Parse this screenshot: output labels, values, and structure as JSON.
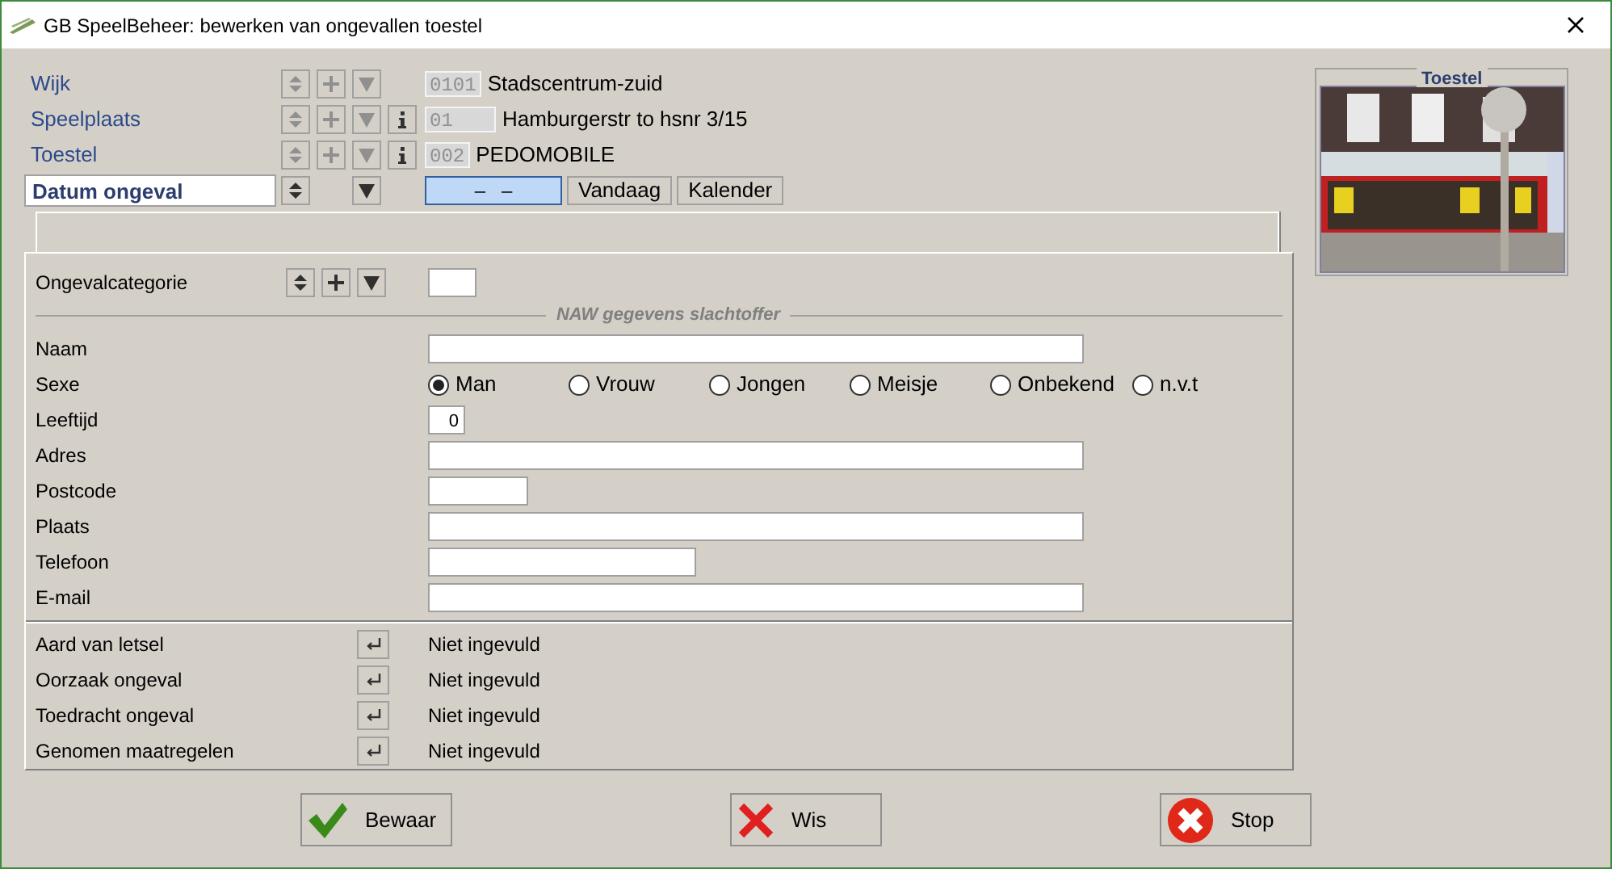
{
  "window": {
    "title": "GB SpeelBeheer: bewerken van ongevallen toestel"
  },
  "rows": [
    {
      "kind": "lookup",
      "label": "Wijk",
      "code": "0101",
      "name": "Stadscentrum-zuid",
      "info": false,
      "selected": false
    },
    {
      "kind": "lookup",
      "label": "Speelplaats",
      "code": "01",
      "name": "Hamburgerstr to hsnr 3/15",
      "info": true,
      "selected": false
    },
    {
      "kind": "lookup",
      "label": "Toestel",
      "code": "002",
      "name": "PEDOMOBILE",
      "info": true,
      "selected": false
    },
    {
      "kind": "date",
      "label": "Datum ongeval",
      "value": "–   –",
      "buttons": [
        "Vandaag",
        "Kalender"
      ],
      "selected": true
    }
  ],
  "category": {
    "label": "Ongevalcategorie"
  },
  "section": {
    "title": "NAW gegevens slachtoffer"
  },
  "fields": [
    {
      "kind": "long",
      "label": "Naam"
    },
    {
      "kind": "radio",
      "label": "Sexe",
      "options": [
        {
          "label": "Man",
          "selected": true
        },
        {
          "label": "Vrouw",
          "selected": false
        },
        {
          "label": "Jongen",
          "selected": false
        },
        {
          "label": "Meisje",
          "selected": false
        },
        {
          "label": "Onbekend",
          "selected": false
        },
        {
          "label": "n.v.t",
          "selected": false
        }
      ]
    },
    {
      "kind": "number",
      "label": "Leeftijd",
      "value": "0"
    },
    {
      "kind": "long",
      "label": "Adres"
    },
    {
      "kind": "short",
      "label": "Postcode"
    },
    {
      "kind": "long",
      "label": "Plaats"
    },
    {
      "kind": "medium",
      "label": "Telefoon"
    },
    {
      "kind": "long",
      "label": "E-mail"
    }
  ],
  "lookups": [
    {
      "label": "Aard van letsel",
      "value": "Niet ingevuld"
    },
    {
      "label": "Oorzaak ongeval",
      "value": "Niet ingevuld"
    },
    {
      "label": "Toedracht ongeval",
      "value": "Niet ingevuld"
    },
    {
      "label": "Genomen maatregelen",
      "value": "Niet ingevuld"
    }
  ],
  "photo": {
    "title": "Toestel",
    "kind": "picture"
  },
  "buttons": [
    {
      "kind": "save",
      "label": "Bewaar"
    },
    {
      "kind": "clear",
      "label": "Wis"
    },
    {
      "kind": "stop",
      "label": "Stop"
    }
  ]
}
